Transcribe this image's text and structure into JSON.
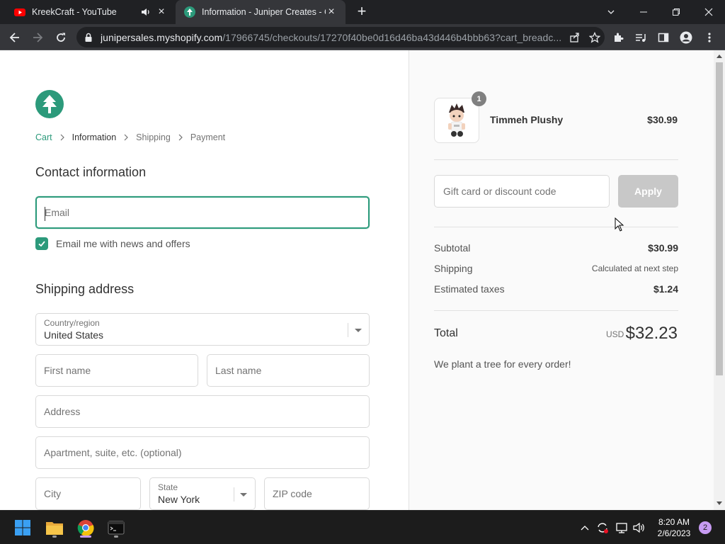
{
  "browser": {
    "tabs": [
      {
        "title": "KreekCraft - YouTube",
        "active": false
      },
      {
        "title": "Information - Juniper Creates - C",
        "active": true
      }
    ],
    "url_host": "junipersales.myshopify.com",
    "url_path": "/17966745/checkouts/17270f40be0d16d46ba43d446b4bbb63?cart_breadc...",
    "icons": [
      "back-icon",
      "forward-icon",
      "reload-icon",
      "lock-icon",
      "share-icon",
      "star-icon",
      "extensions-icon",
      "media-icon",
      "sidepanel-icon",
      "profile-icon",
      "menu-icon"
    ]
  },
  "checkout": {
    "breadcrumb": [
      {
        "label": "Cart",
        "state": "link"
      },
      {
        "label": "Information",
        "state": "current"
      },
      {
        "label": "Shipping",
        "state": "upcoming"
      },
      {
        "label": "Payment",
        "state": "upcoming"
      }
    ],
    "contact_title": "Contact information",
    "email_placeholder": "Email",
    "newsletter_label": "Email me with news and offers",
    "newsletter_checked": true,
    "shipping_title": "Shipping address",
    "country_label": "Country/region",
    "country_value": "United States",
    "first_name_placeholder": "First name",
    "last_name_placeholder": "Last name",
    "address_placeholder": "Address",
    "apartment_placeholder": "Apartment, suite, etc. (optional)",
    "city_placeholder": "City",
    "state_label": "State",
    "state_value": "New York",
    "zip_placeholder": "ZIP code"
  },
  "summary": {
    "product": {
      "name": "Timmeh Plushy",
      "price": "$30.99",
      "quantity": "1"
    },
    "gift_placeholder": "Gift card or discount code",
    "apply_label": "Apply",
    "subtotal_label": "Subtotal",
    "subtotal_value": "$30.99",
    "shipping_label": "Shipping",
    "shipping_value": "Calculated at next step",
    "taxes_label": "Estimated taxes",
    "taxes_value": "$1.24",
    "total_label": "Total",
    "total_currency": "USD",
    "total_value": "$32.23",
    "tree_message": "We plant a tree for every order!"
  },
  "taskbar": {
    "time": "8:20 AM",
    "date": "2/6/2023",
    "notification_count": "2"
  },
  "colors": {
    "accent": "#2c9a7b",
    "chrome_dark": "#202124",
    "chrome_toolbar": "#35363a"
  }
}
